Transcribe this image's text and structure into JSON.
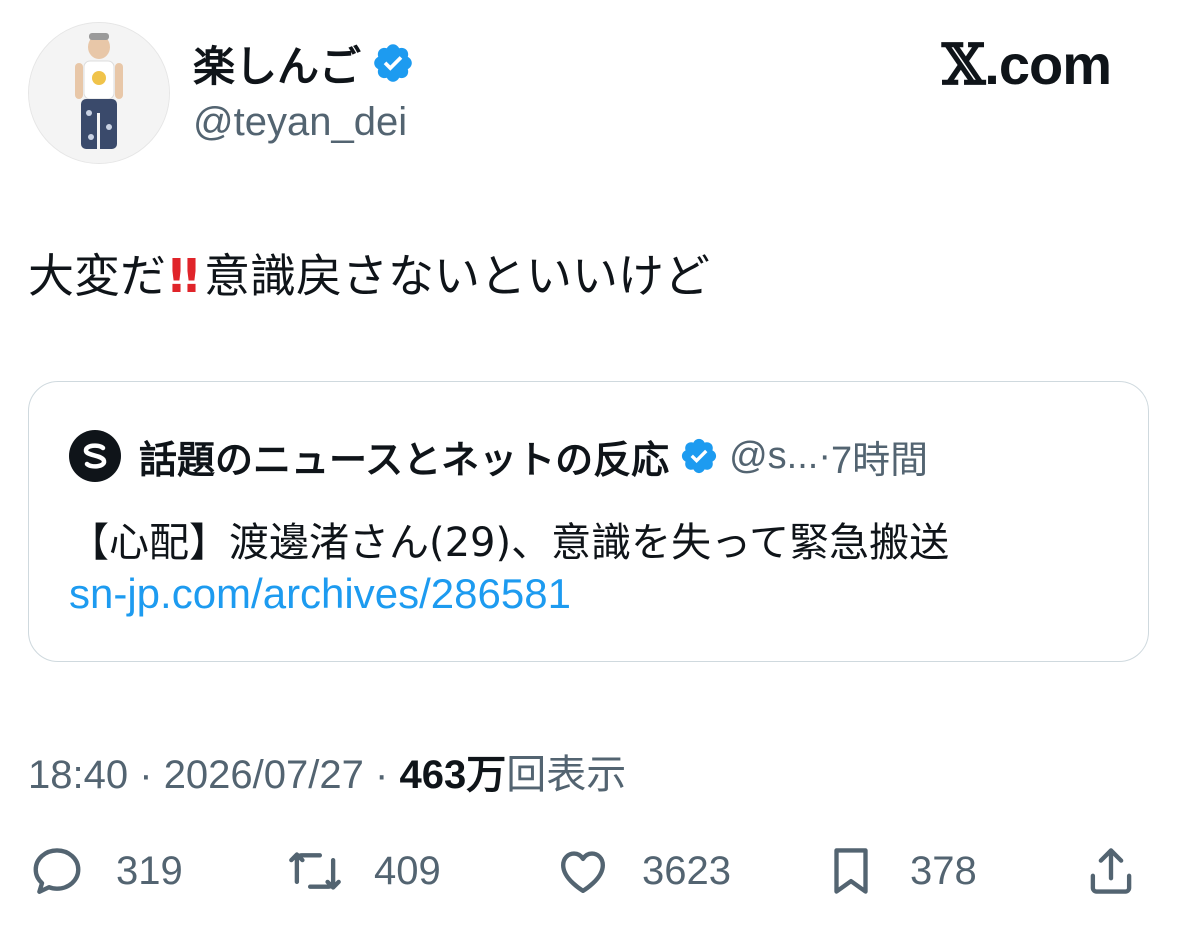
{
  "author": {
    "display_name": "楽しんご",
    "handle": "@teyan_dei",
    "verified": true,
    "verified_color": "#1d9bf0"
  },
  "brand": {
    "mark": "𝕏",
    "domain": ".com"
  },
  "tweet": {
    "text_before_emoji": "大変だ",
    "emoji": "‼️",
    "emoji_name": "double-exclamation-emoji",
    "text_after_emoji": "意識戻さないといいけど"
  },
  "quote": {
    "avatar_icon": "s-logo-icon",
    "name": "話題のニュースとネットの反応",
    "verified": true,
    "handle_truncated": "@s...",
    "separator": "·",
    "time_ago": "7時間",
    "text": "【心配】渡邊渚さん(29)、意識を失って緊急搬送",
    "link": "sn-jp.com/archives/286581",
    "link_color": "#1d9bf0"
  },
  "meta": {
    "time": "18:40",
    "separator": "·",
    "date": "2026/07/27",
    "views_count": "463万",
    "views_label": "回表示"
  },
  "actions": {
    "reply": {
      "icon": "reply-icon",
      "count": "319"
    },
    "retweet": {
      "icon": "retweet-icon",
      "count": "409"
    },
    "like": {
      "icon": "heart-icon",
      "count": "3623"
    },
    "bookmark": {
      "icon": "bookmark-icon",
      "count": "378"
    },
    "share": {
      "icon": "share-icon"
    }
  },
  "colors": {
    "text_primary": "#0f1419",
    "text_secondary": "#536471",
    "border": "#cfd9de",
    "emoji_red": "#e0242a"
  }
}
